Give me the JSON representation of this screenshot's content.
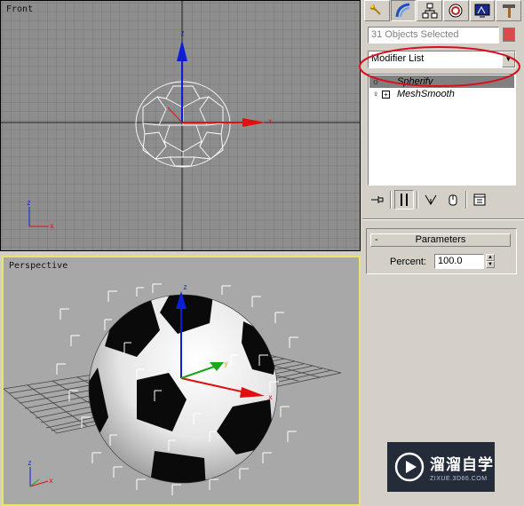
{
  "viewports": {
    "front": {
      "label": "Front"
    },
    "perspective": {
      "label": "Perspective"
    }
  },
  "axes": {
    "x": "x",
    "y": "y",
    "z": "z"
  },
  "command_panel": {
    "tabs": [
      {
        "name": "create-tab",
        "icon": "create-icon"
      },
      {
        "name": "modify-tab",
        "icon": "modify-icon"
      },
      {
        "name": "hierarchy-tab",
        "icon": "hierarchy-icon"
      },
      {
        "name": "motion-tab",
        "icon": "motion-icon"
      },
      {
        "name": "display-tab",
        "icon": "display-icon"
      },
      {
        "name": "utilities-tab",
        "icon": "hammer-icon"
      }
    ],
    "object_name": "31 Objects Selected",
    "object_color": "#d94b4b",
    "modifier_list": {
      "label": "Modifier List"
    },
    "modifier_stack": [
      {
        "label": "Spherify",
        "selected": true
      },
      {
        "label": "MeshSmooth",
        "selected": false
      }
    ],
    "stack_toolbar": [
      "pin-stack-icon",
      "show-end-result-icon",
      "make-unique-icon",
      "remove-modifier-icon",
      "configure-modifier-sets-icon"
    ],
    "parameters": {
      "title": "Parameters",
      "collapse_symbol": "-",
      "percent_label": "Percent:",
      "percent_value": "100.0"
    }
  },
  "highlight": {
    "color": "#d8101c"
  },
  "watermark": {
    "main": "溜溜自学",
    "sub": "ZIXUE.3D66.COM"
  }
}
